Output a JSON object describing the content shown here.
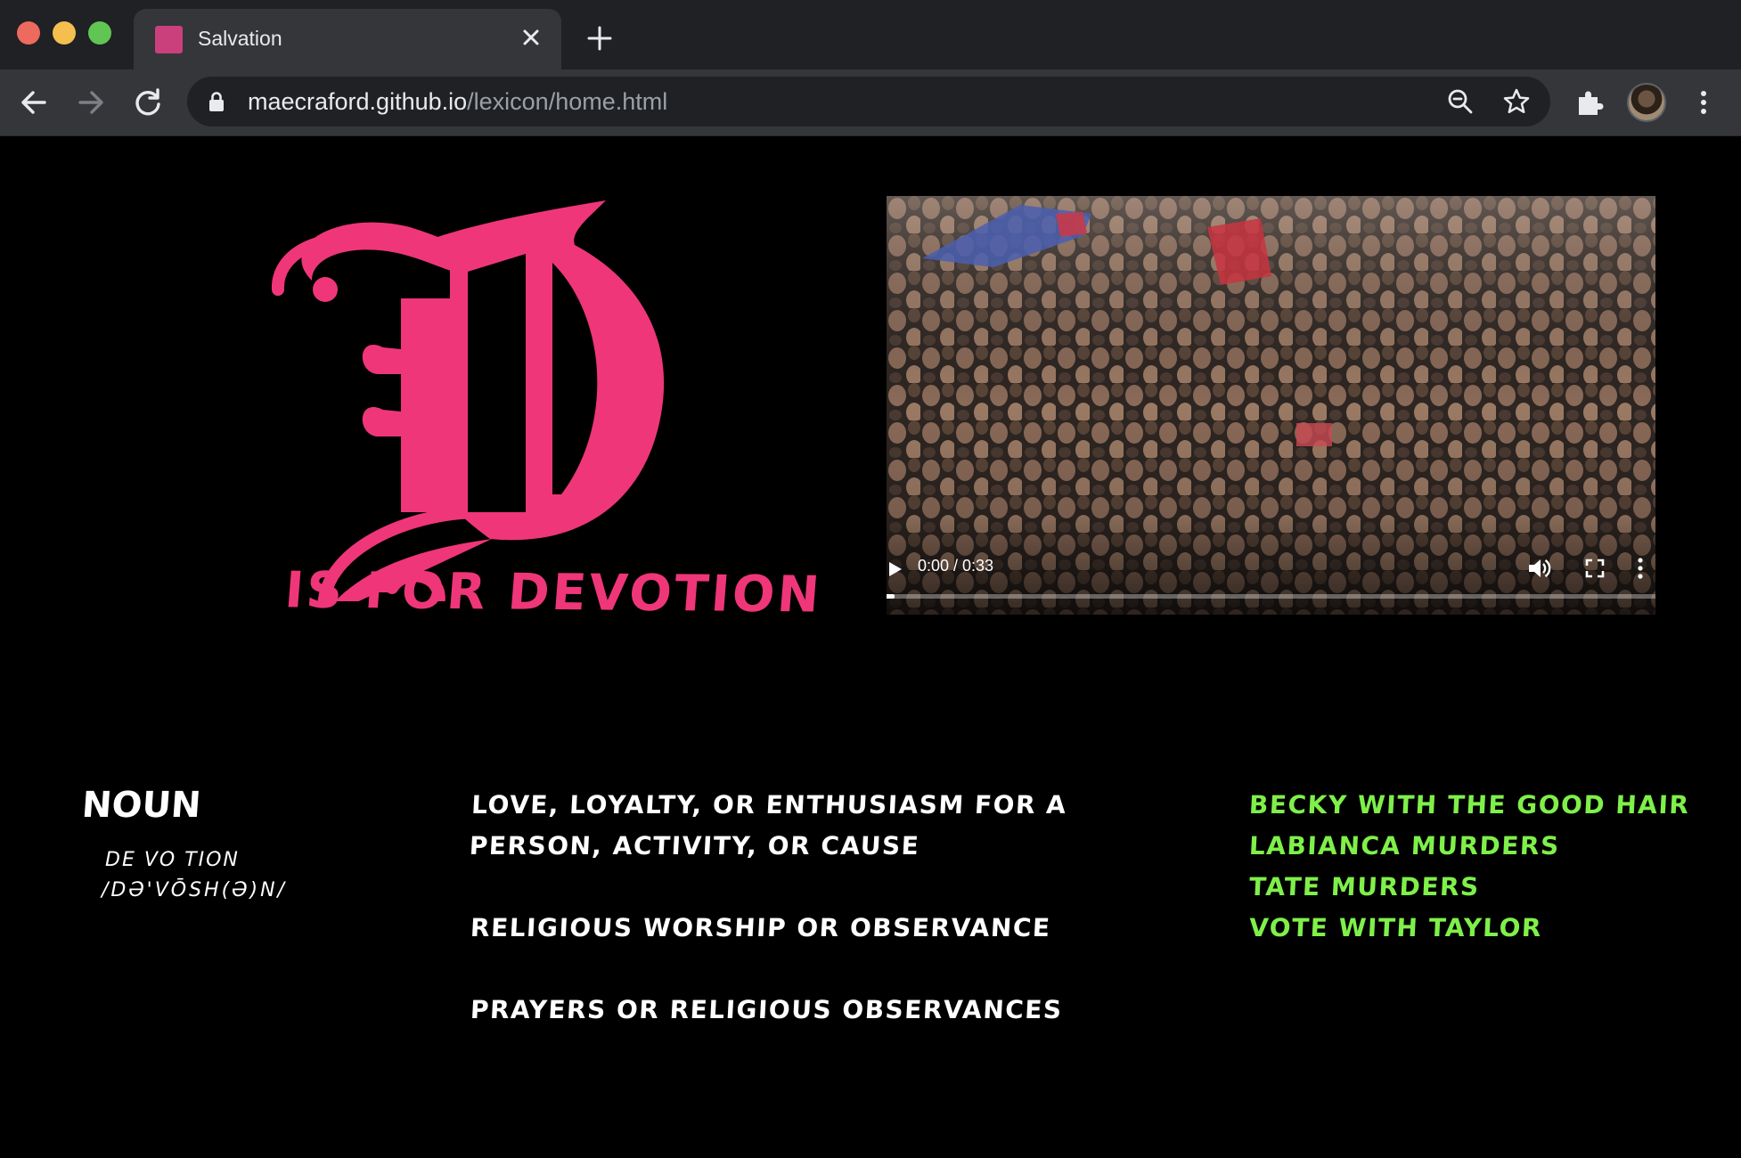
{
  "browser": {
    "tab_title": "Salvation",
    "url_host": "maecraford.github.io",
    "url_path": "/lexicon/home.html",
    "favicon_color": "#c9407d"
  },
  "hero": {
    "tagline": "is for devotion",
    "letter_color": "#ef3678"
  },
  "video": {
    "time": "0:00 / 0:33",
    "progress_fraction": 0.02
  },
  "entry": {
    "part_of_speech": "Noun",
    "syllables": "de vo tion",
    "pronunciation": "/də'vōSH(ə)n/",
    "definitions": [
      "love, loyalty, or enthusiasm for a person, activity, or cause",
      "religious worship or observance",
      "prayers or religious observances"
    ],
    "related": [
      "Becky with the good hair",
      "LaBianca murders",
      "Tate murders",
      "Vote with Taylor"
    ],
    "related_color": "#7ff04a"
  }
}
